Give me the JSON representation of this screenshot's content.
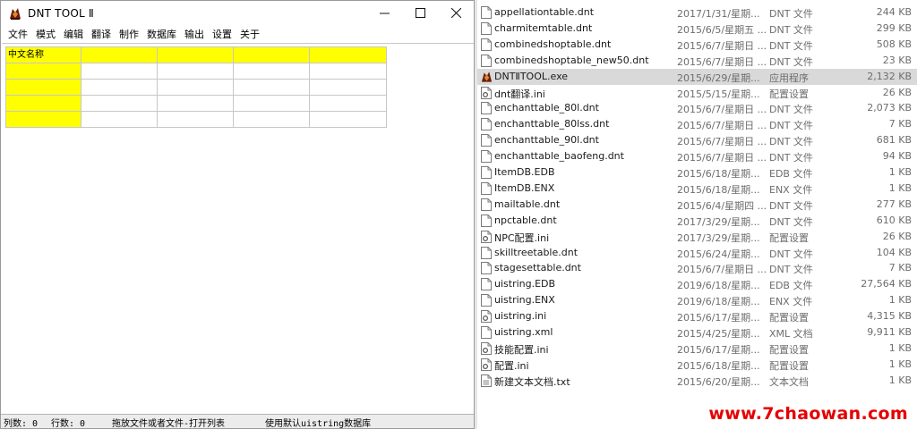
{
  "app": {
    "title": "DNT TOOL Ⅱ",
    "window_buttons": {
      "minimize": "—",
      "maximize": "☐",
      "close": "✕"
    },
    "menu": [
      "文件",
      "模式",
      "编辑",
      "翻译",
      "制作",
      "数据库",
      "输出",
      "设置",
      "关于"
    ],
    "grid": {
      "header_cell": "中文名称",
      "accent_color": "#ffff00"
    },
    "status": {
      "cols": "列数: 0",
      "rows": "行数: 0",
      "hint": "拖放文件或者文件-打开列表",
      "db": "使用默认uistring数据库"
    }
  },
  "files": [
    {
      "name": "appellationtable.dnt",
      "date": "2017/1/31/星期...",
      "type": "DNT 文件",
      "size": "244 KB",
      "icon": "file-icon"
    },
    {
      "name": "charmitemtable.dnt",
      "date": "2015/6/5/星期五 ...",
      "type": "DNT 文件",
      "size": "299 KB",
      "icon": "file-icon"
    },
    {
      "name": "combinedshoptable.dnt",
      "date": "2015/6/7/星期日 ...",
      "type": "DNT 文件",
      "size": "508 KB",
      "icon": "file-icon"
    },
    {
      "name": "combinedshoptable_new50.dnt",
      "date": "2015/6/7/星期日 ...",
      "type": "DNT 文件",
      "size": "23 KB",
      "icon": "file-icon"
    },
    {
      "name": "DNTⅡTOOL.exe",
      "date": "2015/6/29/星期...",
      "type": "应用程序",
      "size": "2,132 KB",
      "icon": "app-icon",
      "selected": true
    },
    {
      "name": "dnt翻译.ini",
      "date": "2015/5/15/星期...",
      "type": "配置设置",
      "size": "26 KB",
      "icon": "settings-file-icon"
    },
    {
      "name": "enchanttable_80l.dnt",
      "date": "2015/6/7/星期日 ...",
      "type": "DNT 文件",
      "size": "2,073 KB",
      "icon": "file-icon"
    },
    {
      "name": "enchanttable_80lss.dnt",
      "date": "2015/6/7/星期日 ...",
      "type": "DNT 文件",
      "size": "7 KB",
      "icon": "file-icon"
    },
    {
      "name": "enchanttable_90l.dnt",
      "date": "2015/6/7/星期日 ...",
      "type": "DNT 文件",
      "size": "681 KB",
      "icon": "file-icon"
    },
    {
      "name": "enchanttable_baofeng.dnt",
      "date": "2015/6/7/星期日 ...",
      "type": "DNT 文件",
      "size": "94 KB",
      "icon": "file-icon"
    },
    {
      "name": "ItemDB.EDB",
      "date": "2015/6/18/星期...",
      "type": "EDB 文件",
      "size": "1 KB",
      "icon": "file-icon"
    },
    {
      "name": "ItemDB.ENX",
      "date": "2015/6/18/星期...",
      "type": "ENX 文件",
      "size": "1 KB",
      "icon": "file-icon"
    },
    {
      "name": "mailtable.dnt",
      "date": "2015/6/4/星期四 ...",
      "type": "DNT 文件",
      "size": "277 KB",
      "icon": "file-icon"
    },
    {
      "name": "npctable.dnt",
      "date": "2017/3/29/星期...",
      "type": "DNT 文件",
      "size": "610 KB",
      "icon": "file-icon"
    },
    {
      "name": "NPC配置.ini",
      "date": "2017/3/29/星期...",
      "type": "配置设置",
      "size": "26 KB",
      "icon": "settings-file-icon"
    },
    {
      "name": "skilltreetable.dnt",
      "date": "2015/6/24/星期...",
      "type": "DNT 文件",
      "size": "104 KB",
      "icon": "file-icon"
    },
    {
      "name": "stagesettable.dnt",
      "date": "2015/6/7/星期日 ...",
      "type": "DNT 文件",
      "size": "7 KB",
      "icon": "file-icon"
    },
    {
      "name": "uistring.EDB",
      "date": "2019/6/18/星期...",
      "type": "EDB 文件",
      "size": "27,564 KB",
      "icon": "file-icon"
    },
    {
      "name": "uistring.ENX",
      "date": "2019/6/18/星期...",
      "type": "ENX 文件",
      "size": "1 KB",
      "icon": "file-icon"
    },
    {
      "name": "uistring.ini",
      "date": "2015/6/17/星期...",
      "type": "配置设置",
      "size": "4,315 KB",
      "icon": "settings-file-icon"
    },
    {
      "name": "uistring.xml",
      "date": "2015/4/25/星期...",
      "type": "XML 文档",
      "size": "9,911 KB",
      "icon": "file-icon"
    },
    {
      "name": "技能配置.ini",
      "date": "2015/6/17/星期...",
      "type": "配置设置",
      "size": "1 KB",
      "icon": "settings-file-icon"
    },
    {
      "name": "配置.ini",
      "date": "2015/6/18/星期...",
      "type": "配置设置",
      "size": "1 KB",
      "icon": "settings-file-icon"
    },
    {
      "name": "新建文本文档.txt",
      "date": "2015/6/20/星期...",
      "type": "文本文档",
      "size": "1 KB",
      "icon": "text-file-icon"
    }
  ],
  "watermark": "www.7chaowan.com"
}
